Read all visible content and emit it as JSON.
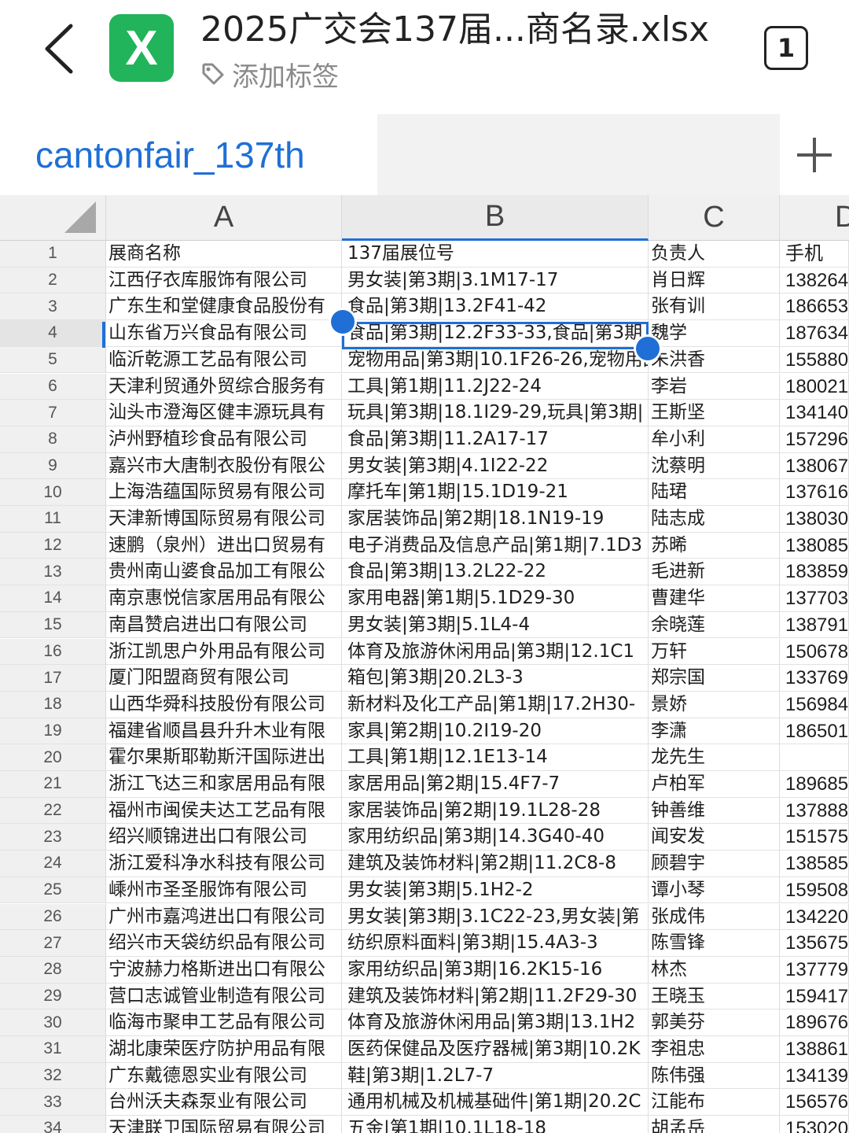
{
  "header": {
    "back_icon": "chevron-left-icon",
    "file_icon": "excel-file-icon",
    "file_icon_letter": "X",
    "title": "2025广交会137届...商名录.xlsx",
    "add_tag_label": "添加标签",
    "page_count": "1"
  },
  "tabs": {
    "active_sheet": "cantonfair_137th",
    "add_sheet_icon": "plus-icon"
  },
  "colors": {
    "accent": "#1f6fd6",
    "excel_green": "#21b45a"
  },
  "grid": {
    "column_headers": [
      "A",
      "B",
      "C",
      "D"
    ],
    "selected_row": 4,
    "selected_column": "B",
    "rows": [
      {
        "n": "1",
        "a": "展商名称",
        "b": "137届展位号",
        "c": "负责人",
        "d": "手机"
      },
      {
        "n": "2",
        "a": "江西仔衣库服饰有限公司",
        "b": "男女装|第3期|3.1M17-17",
        "c": "肖日辉",
        "d": "138264"
      },
      {
        "n": "3",
        "a": "广东生和堂健康食品股份有",
        "b": "食品|第3期|13.2F41-42",
        "c": "张有训",
        "d": "186653"
      },
      {
        "n": "4",
        "a": "山东省万兴食品有限公司",
        "b": "食品|第3期|12.2F33-33,食品|第3期",
        "c": "魏学",
        "d": "187634"
      },
      {
        "n": "5",
        "a": "临沂乾源工艺品有限公司",
        "b": "宠物用品|第3期|10.1F26-26,宠物用品",
        "c": "朱洪香",
        "d": "155880"
      },
      {
        "n": "6",
        "a": "天津利贸通外贸综合服务有",
        "b": "工具|第1期|11.2J22-24",
        "c": "李岩",
        "d": "180021"
      },
      {
        "n": "7",
        "a": "汕头市澄海区健丰源玩具有",
        "b": "玩具|第3期|18.1I29-29,玩具|第3期|",
        "c": "王斯坚",
        "d": "134140"
      },
      {
        "n": "8",
        "a": "泸州野植珍食品有限公司",
        "b": "食品|第3期|11.2A17-17",
        "c": "牟小利",
        "d": "157296"
      },
      {
        "n": "9",
        "a": "嘉兴市大唐制衣股份有限公",
        "b": "男女装|第3期|4.1I22-22",
        "c": "沈蔡明",
        "d": "138067"
      },
      {
        "n": "10",
        "a": "上海浩蕴国际贸易有限公司",
        "b": "摩托车|第1期|15.1D19-21",
        "c": "陆珺",
        "d": "137616"
      },
      {
        "n": "11",
        "a": "天津新博国际贸易有限公司",
        "b": "家居装饰品|第2期|18.1N19-19",
        "c": "陆志成",
        "d": "138030"
      },
      {
        "n": "12",
        "a": "速鹏（泉州）进出口贸易有",
        "b": "电子消费品及信息产品|第1期|7.1D3",
        "c": "苏晞",
        "d": "138085"
      },
      {
        "n": "13",
        "a": "贵州南山婆食品加工有限公",
        "b": "食品|第3期|13.2L22-22",
        "c": "毛进新",
        "d": "183859"
      },
      {
        "n": "14",
        "a": "南京惠悦信家居用品有限公",
        "b": "家用电器|第1期|5.1D29-30",
        "c": "曹建华",
        "d": "137703"
      },
      {
        "n": "15",
        "a": "南昌赞启进出口有限公司",
        "b": "男女装|第3期|5.1L4-4",
        "c": "余晓莲",
        "d": "138791"
      },
      {
        "n": "16",
        "a": "浙江凯思户外用品有限公司",
        "b": "体育及旅游休闲用品|第3期|12.1C1",
        "c": "万轩",
        "d": "150678"
      },
      {
        "n": "17",
        "a": "厦门阳盟商贸有限公司",
        "b": "箱包|第3期|20.2L3-3",
        "c": "郑宗国",
        "d": "133769"
      },
      {
        "n": "18",
        "a": "山西华舜科技股份有限公司",
        "b": "新材料及化工产品|第1期|17.2H30-",
        "c": "景娇",
        "d": "156984"
      },
      {
        "n": "19",
        "a": "福建省顺昌县升升木业有限",
        "b": "家具|第2期|10.2I19-20",
        "c": "李潇",
        "d": "186501"
      },
      {
        "n": "20",
        "a": "霍尔果斯耶勒斯汗国际进出",
        "b": "工具|第1期|12.1E13-14",
        "c": "龙先生",
        "d": ""
      },
      {
        "n": "21",
        "a": "浙江飞达三和家居用品有限",
        "b": "家居用品|第2期|15.4F7-7",
        "c": "卢柏军",
        "d": "189685"
      },
      {
        "n": "22",
        "a": "福州市闽侯夫达工艺品有限",
        "b": "家居装饰品|第2期|19.1L28-28",
        "c": "钟善维",
        "d": "137888"
      },
      {
        "n": "23",
        "a": "绍兴顺锦进出口有限公司",
        "b": "家用纺织品|第3期|14.3G40-40",
        "c": "闻安发",
        "d": "151575"
      },
      {
        "n": "24",
        "a": "浙江爱科净水科技有限公司",
        "b": "建筑及装饰材料|第2期|11.2C8-8",
        "c": "顾碧宇",
        "d": "138585"
      },
      {
        "n": "25",
        "a": "嵊州市圣圣服饰有限公司",
        "b": "男女装|第3期|5.1H2-2",
        "c": "谭小琴",
        "d": "159508"
      },
      {
        "n": "26",
        "a": "广州市嘉鸿进出口有限公司",
        "b": "男女装|第3期|3.1C22-23,男女装|第",
        "c": "张成伟",
        "d": "134220"
      },
      {
        "n": "27",
        "a": "绍兴市天袋纺织品有限公司",
        "b": "纺织原料面料|第3期|15.4A3-3",
        "c": "陈雪锋",
        "d": "135675"
      },
      {
        "n": "28",
        "a": "宁波赫力格斯进出口有限公",
        "b": "家用纺织品|第3期|16.2K15-16",
        "c": "林杰",
        "d": "137779"
      },
      {
        "n": "29",
        "a": "营口志诚管业制造有限公司",
        "b": "建筑及装饰材料|第2期|11.2F29-30",
        "c": "王晓玉",
        "d": "159417"
      },
      {
        "n": "30",
        "a": "临海市聚申工艺品有限公司",
        "b": "体育及旅游休闲用品|第3期|13.1H2",
        "c": "郭美芬",
        "d": "189676"
      },
      {
        "n": "31",
        "a": "湖北康荣医疗防护用品有限",
        "b": "医药保健品及医疗器械|第3期|10.2K",
        "c": "李祖忠",
        "d": "138861"
      },
      {
        "n": "32",
        "a": "广东戴德恩实业有限公司",
        "b": "鞋|第3期|1.2L7-7",
        "c": "陈伟强",
        "d": "134139"
      },
      {
        "n": "33",
        "a": "台州沃夫森泵业有限公司",
        "b": "通用机械及机械基础件|第1期|20.2C",
        "c": "江能布",
        "d": "156576"
      },
      {
        "n": "34",
        "a": "天津联卫国际贸易有限公司",
        "b": "五金|第1期|10.1L18-18",
        "c": "胡孟岳",
        "d": "153020"
      }
    ]
  }
}
